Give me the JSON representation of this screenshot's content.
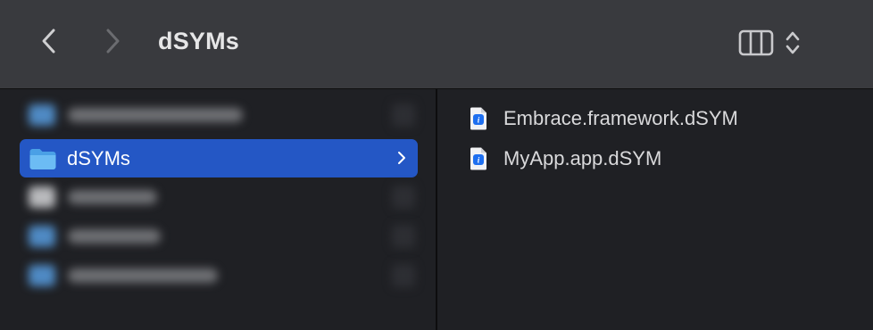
{
  "toolbar": {
    "title": "dSYMs",
    "back_icon": "chevron-left-icon",
    "forward_icon": "chevron-right-icon",
    "view_icon": "columns-view-icon",
    "view_options_icon": "chevron-up-down-icon"
  },
  "sidebar": {
    "selected": {
      "label": "dSYMs",
      "icon": "folder-icon",
      "disclosure_icon": "chevron-right-icon"
    }
  },
  "files": [
    {
      "name": "Embrace.framework.dSYM",
      "icon": "document-icon"
    },
    {
      "name": "MyApp.app.dSYM",
      "icon": "document-icon"
    }
  ],
  "colors": {
    "toolbar_bg": "#393a3e",
    "content_bg": "#1f2024",
    "selection": "#2457c5",
    "text": "#d9d9db",
    "folder_blue": "#5fb3f0"
  }
}
